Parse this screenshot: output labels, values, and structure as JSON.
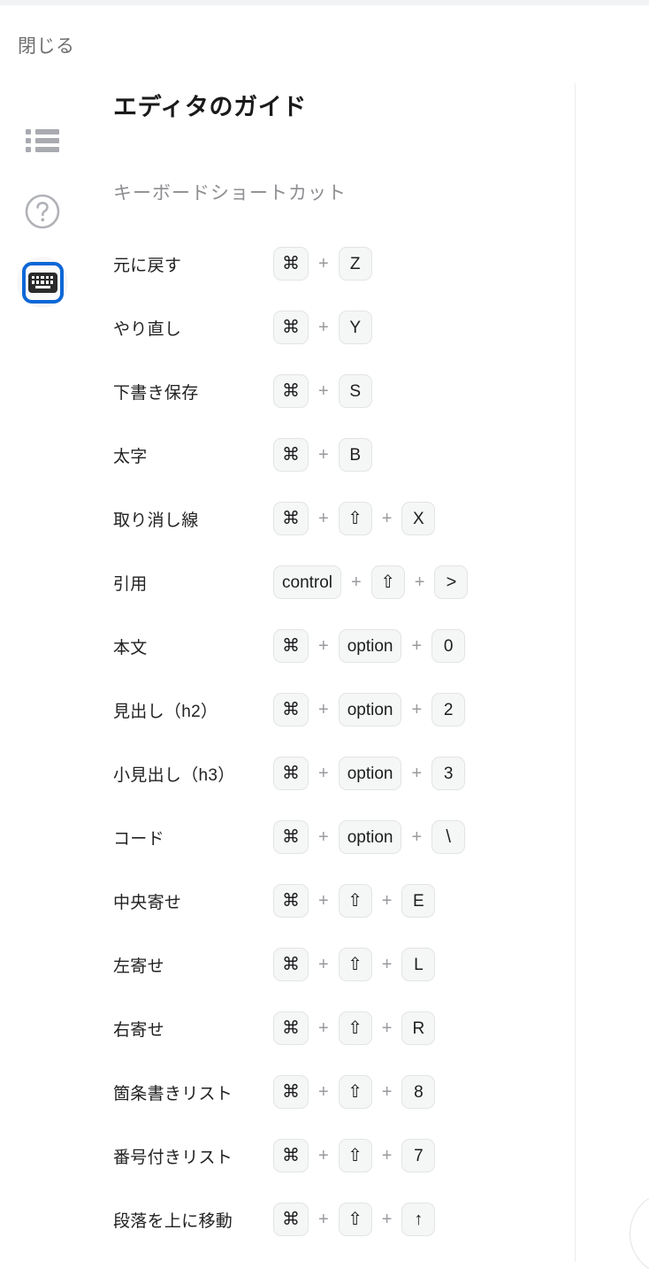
{
  "window": {
    "accent_color": "#0c67d6",
    "key_bg_color": "#f5f6f6",
    "key_border_color": "#e3e4e5",
    "muted_text_color": "#8e8e92"
  },
  "close_button": {
    "label": "閉じる"
  },
  "rail": {
    "items": [
      {
        "name": "list-view",
        "icon": "list-icon",
        "active": false
      },
      {
        "name": "help",
        "icon": "question-circle-icon",
        "active": false
      },
      {
        "name": "keyboard-shortcuts",
        "icon": "keyboard-icon",
        "active": true
      }
    ]
  },
  "panel": {
    "title": "エディタのガイド",
    "section_label": "キーボードショートカット"
  },
  "shortcuts": [
    {
      "label": "元に戻す",
      "keys": [
        "⌘",
        "Z"
      ]
    },
    {
      "label": "やり直し",
      "keys": [
        "⌘",
        "Y"
      ]
    },
    {
      "label": "下書き保存",
      "keys": [
        "⌘",
        "S"
      ]
    },
    {
      "label": "太字",
      "keys": [
        "⌘",
        "B"
      ]
    },
    {
      "label": "取り消し線",
      "keys": [
        "⌘",
        "⇧",
        "X"
      ]
    },
    {
      "label": "引用",
      "keys": [
        "control",
        "⇧",
        ">"
      ]
    },
    {
      "label": "本文",
      "keys": [
        "⌘",
        "option",
        "0"
      ]
    },
    {
      "label": "見出し（h2）",
      "keys": [
        "⌘",
        "option",
        "2"
      ]
    },
    {
      "label": "小見出し（h3）",
      "keys": [
        "⌘",
        "option",
        "3"
      ]
    },
    {
      "label": "コード",
      "keys": [
        "⌘",
        "option",
        "\\"
      ]
    },
    {
      "label": "中央寄せ",
      "keys": [
        "⌘",
        "⇧",
        "E"
      ]
    },
    {
      "label": "左寄せ",
      "keys": [
        "⌘",
        "⇧",
        "L"
      ]
    },
    {
      "label": "右寄せ",
      "keys": [
        "⌘",
        "⇧",
        "R"
      ]
    },
    {
      "label": "箇条書きリスト",
      "keys": [
        "⌘",
        "⇧",
        "8"
      ]
    },
    {
      "label": "番号付きリスト",
      "keys": [
        "⌘",
        "⇧",
        "7"
      ]
    },
    {
      "label": "段落を上に移動",
      "keys": [
        "⌘",
        "⇧",
        "↑"
      ]
    }
  ],
  "separator": {
    "symbol": "+"
  }
}
